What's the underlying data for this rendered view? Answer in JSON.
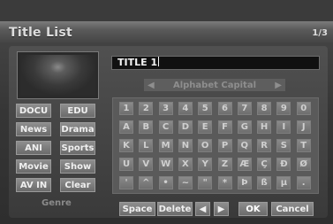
{
  "header": {
    "title": "Title List",
    "page": "1/3"
  },
  "title_field": {
    "value": "TITLE 1"
  },
  "charset": {
    "label": "Alphabet Capital",
    "left_arrow": "◀",
    "right_arrow": "▶"
  },
  "genre": {
    "label": "Genre",
    "buttons": [
      "DOCU",
      "EDU",
      "News",
      "Drama",
      "ANI",
      "Sports",
      "Movie",
      "Show",
      "AV IN",
      "Clear"
    ]
  },
  "keyboard": {
    "rows": [
      [
        "1",
        "2",
        "3",
        "4",
        "5",
        "6",
        "7",
        "8",
        "9",
        "0"
      ],
      [
        "A",
        "B",
        "C",
        "D",
        "E",
        "F",
        "G",
        "H",
        "I",
        "J"
      ],
      [
        "K",
        "L",
        "M",
        "N",
        "O",
        "P",
        "Q",
        "R",
        "S",
        "T"
      ],
      [
        "U",
        "V",
        "W",
        "X",
        "Y",
        "Z",
        "Æ",
        "Ç",
        "Ð",
        "Ø"
      ],
      [
        "'",
        "^",
        "•",
        "~",
        "\"",
        "*",
        "Þ",
        "ß",
        "µ",
        "."
      ]
    ]
  },
  "actions": {
    "space": "Space",
    "delete": "Delete",
    "left": "◀",
    "right": "▶",
    "ok": "OK",
    "cancel": "Cancel"
  }
}
